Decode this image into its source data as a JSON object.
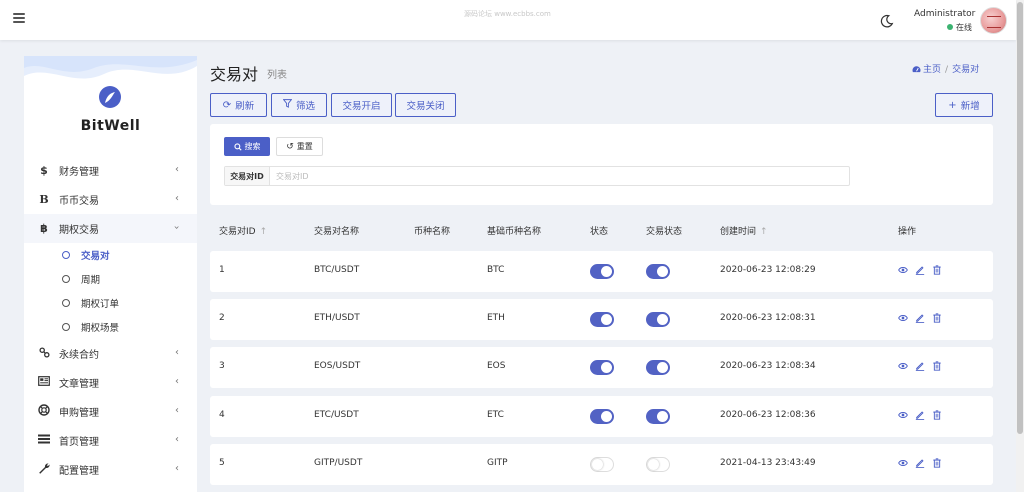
{
  "header": {
    "watermark": "源码论坛 www.ecbbs.com",
    "admin_name": "Administrator",
    "status": "在线"
  },
  "sidebar": {
    "brand": "BitWell",
    "items": [
      {
        "label": "财务管理",
        "icon": "dollar-icon"
      },
      {
        "label": "币币交易",
        "icon": "bold-b-icon"
      },
      {
        "label": "期权交易",
        "icon": "bitcoin-icon",
        "expanded": true,
        "children": [
          {
            "label": "交易对",
            "active": true
          },
          {
            "label": "周期"
          },
          {
            "label": "期权订单"
          },
          {
            "label": "期权场景"
          }
        ]
      },
      {
        "label": "永续合约",
        "icon": "link-icon"
      },
      {
        "label": "文章管理",
        "icon": "newspaper-icon"
      },
      {
        "label": "申购管理",
        "icon": "lifebuoy-icon"
      },
      {
        "label": "首页管理",
        "icon": "bars-icon"
      },
      {
        "label": "配置管理",
        "icon": "wrench-icon"
      }
    ]
  },
  "page": {
    "title": "交易对",
    "subtitle": "列表",
    "breadcrumb": {
      "home": "主页",
      "current": "交易对"
    }
  },
  "toolbar": {
    "refresh": "刷新",
    "filter": "筛选",
    "enable": "交易开启",
    "disable": "交易关闭",
    "add": "新增"
  },
  "search": {
    "search_button": "搜索",
    "reset_button": "重置",
    "field_label": "交易对ID",
    "placeholder": "交易对ID",
    "value": ""
  },
  "table": {
    "columns": [
      "交易对ID",
      "交易对名称",
      "币种名称",
      "基础币种名称",
      "状态",
      "交易状态",
      "创建时间",
      "操作"
    ],
    "rows": [
      {
        "id": "1",
        "name": "BTC/USDT",
        "coin": "",
        "base": "BTC",
        "status": true,
        "trade": true,
        "created": "2020-06-23 12:08:29"
      },
      {
        "id": "2",
        "name": "ETH/USDT",
        "coin": "",
        "base": "ETH",
        "status": true,
        "trade": true,
        "created": "2020-06-23 12:08:31"
      },
      {
        "id": "3",
        "name": "EOS/USDT",
        "coin": "",
        "base": "EOS",
        "status": true,
        "trade": true,
        "created": "2020-06-23 12:08:34"
      },
      {
        "id": "4",
        "name": "ETC/USDT",
        "coin": "",
        "base": "ETC",
        "status": true,
        "trade": true,
        "created": "2020-06-23 12:08:36"
      },
      {
        "id": "5",
        "name": "GITP/USDT",
        "coin": "",
        "base": "GITP",
        "status": false,
        "trade": false,
        "created": "2021-04-13 23:43:49"
      }
    ]
  },
  "colors": {
    "accent": "#4b5fc7",
    "toggle_on": "#5262c4",
    "online": "#3cb371"
  }
}
